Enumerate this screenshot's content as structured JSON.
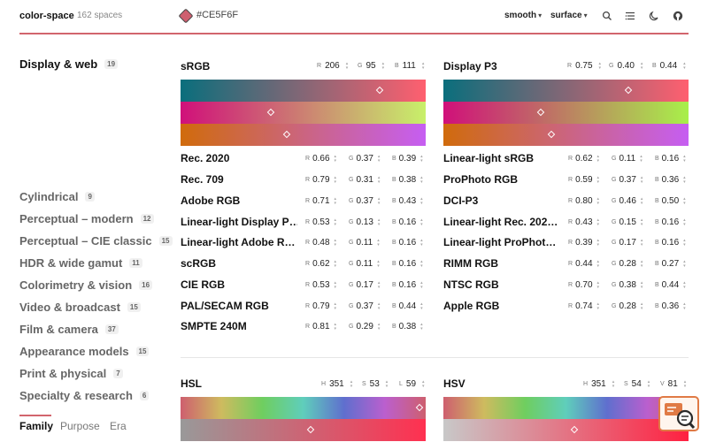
{
  "header": {
    "brand": "color-space",
    "count": "162 spaces",
    "hex": "#CE5F6F",
    "swatch_color": "#CE5F6F",
    "accent_color": "#d2656d",
    "interp_select": "smooth",
    "mode_select": "surface",
    "icons": [
      "search-icon",
      "list-icon",
      "moon-icon",
      "github-icon"
    ]
  },
  "sidebar": {
    "items": [
      {
        "label": "Display & web",
        "count": "19",
        "active": true
      },
      {
        "label": "Cylindrical",
        "count": "9"
      },
      {
        "label": "Perceptual – modern",
        "count": "12"
      },
      {
        "label": "Perceptual – CIE classic",
        "count": "15"
      },
      {
        "label": "HDR & wide gamut",
        "count": "11"
      },
      {
        "label": "Colorimetry & vision",
        "count": "16"
      },
      {
        "label": "Video & broadcast",
        "count": "15"
      },
      {
        "label": "Film & camera",
        "count": "37"
      },
      {
        "label": "Appearance models",
        "count": "15"
      },
      {
        "label": "Print & physical",
        "count": "7"
      },
      {
        "label": "Specialty & research",
        "count": "6"
      }
    ],
    "tabs": [
      {
        "label": "Family",
        "active": true
      },
      {
        "label": "Purpose"
      },
      {
        "label": "Era"
      }
    ]
  },
  "panels": {
    "srgb": {
      "title": "sRGB",
      "channels": [
        {
          "ch": "R",
          "val": "206"
        },
        {
          "ch": "G",
          "val": "95"
        },
        {
          "ch": "B",
          "val": "111"
        }
      ]
    },
    "p3": {
      "title": "Display P3",
      "channels": [
        {
          "ch": "R",
          "val": "0.75"
        },
        {
          "ch": "G",
          "val": "0.40"
        },
        {
          "ch": "B",
          "val": "0.44"
        }
      ]
    },
    "hsl": {
      "title": "HSL",
      "channels": [
        {
          "ch": "H",
          "val": "351"
        },
        {
          "ch": "S",
          "val": "53"
        },
        {
          "ch": "L",
          "val": "59"
        }
      ]
    },
    "hsv": {
      "title": "HSV",
      "channels": [
        {
          "ch": "H",
          "val": "351"
        },
        {
          "ch": "S",
          "val": "54"
        },
        {
          "ch": "V",
          "val": "81"
        }
      ]
    }
  },
  "left_rows": [
    {
      "name": "Rec. 2020",
      "r": "0.66",
      "g": "0.37",
      "b": "0.39"
    },
    {
      "name": "Rec. 709",
      "r": "0.79",
      "g": "0.31",
      "b": "0.38"
    },
    {
      "name": "Adobe RGB",
      "r": "0.71",
      "g": "0.37",
      "b": "0.43"
    },
    {
      "name": "Linear-light Display P…",
      "r": "0.53",
      "g": "0.13",
      "b": "0.16"
    },
    {
      "name": "Linear-light Adobe R…",
      "r": "0.48",
      "g": "0.11",
      "b": "0.16"
    },
    {
      "name": "scRGB",
      "r": "0.62",
      "g": "0.11",
      "b": "0.16"
    },
    {
      "name": "CIE RGB",
      "r": "0.53",
      "g": "0.17",
      "b": "0.16"
    },
    {
      "name": "PAL/SECAM RGB",
      "r": "0.79",
      "g": "0.37",
      "b": "0.44"
    },
    {
      "name": "SMPTE 240M",
      "r": "0.81",
      "g": "0.29",
      "b": "0.38"
    }
  ],
  "right_rows": [
    {
      "name": "Linear-light sRGB",
      "r": "0.62",
      "g": "0.11",
      "b": "0.16"
    },
    {
      "name": "ProPhoto RGB",
      "r": "0.59",
      "g": "0.37",
      "b": "0.36"
    },
    {
      "name": "DCI-P3",
      "r": "0.80",
      "g": "0.46",
      "b": "0.50"
    },
    {
      "name": "Linear-light Rec. 202…",
      "r": "0.43",
      "g": "0.15",
      "b": "0.16"
    },
    {
      "name": "Linear-light ProPhot…",
      "r": "0.39",
      "g": "0.17",
      "b": "0.16"
    },
    {
      "name": "RIMM RGB",
      "r": "0.44",
      "g": "0.28",
      "b": "0.27"
    },
    {
      "name": "NTSC RGB",
      "r": "0.70",
      "g": "0.38",
      "b": "0.44"
    },
    {
      "name": "Apple RGB",
      "r": "0.74",
      "g": "0.28",
      "b": "0.36"
    }
  ]
}
